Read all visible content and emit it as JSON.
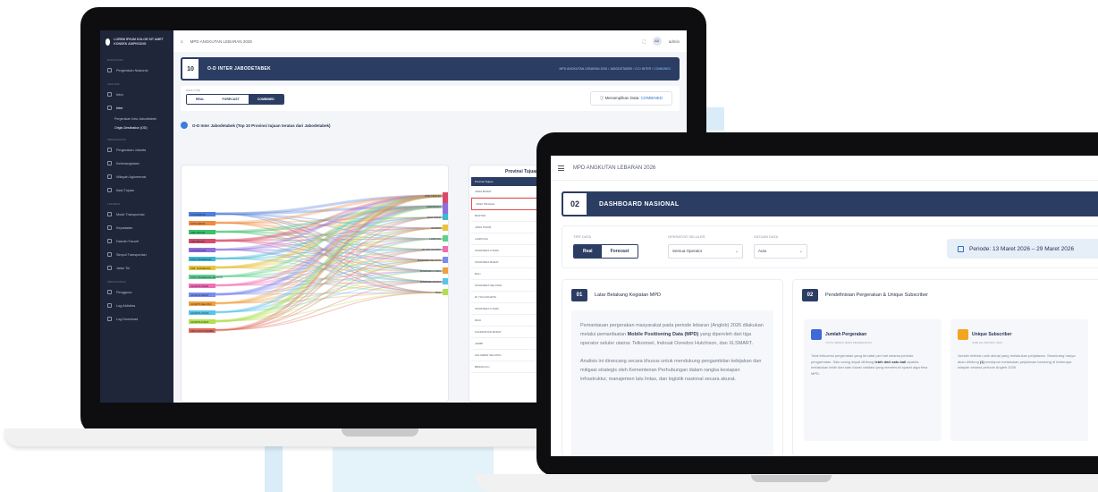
{
  "back_app": {
    "logo_text": "LOREM IPSUM DOLOR SIT AMET\nKONSEK ADIPISCING",
    "topbar_title": "MPD ANGKUTAN LEBARAN 2026",
    "user_initials": "AD",
    "user_name": "admin",
    "sidebar": {
      "sections": [
        "Ringkasan",
        "Analisis",
        "Pergerakan",
        "Laporan",
        "Pengaturan"
      ],
      "items": [
        "Pergerakan Nasional",
        "Intra",
        "Inter",
        "Pergerakan Jakarta",
        "Keberangkatan",
        "Wilayah Aglomerasi",
        "Asal-Tujuan",
        "Mode Transportasi",
        "Kepadatan",
        "Daerah Favorit",
        "Simpul Transportasi",
        "Jalan Tol",
        "Jalan Arteri",
        "Pengguna",
        "Log Aktivitas",
        "Log Download"
      ],
      "sub_items": [
        "Pergerakan Intra Jabodetabek",
        "Origin-Destination (OD)"
      ]
    },
    "header": {
      "number": "10",
      "title": "O-D INTER JABODETABEK",
      "breadcrumb": "MPD ANGKUTAN LEBARAN 2026 / JABODETABEK / O-D INTER /",
      "breadcrumb_active": "COMBINED"
    },
    "filter": {
      "label": "DATA TYPE",
      "options": [
        "REAL",
        "FORECAST",
        "COMBINED"
      ],
      "selected": "COMBINED",
      "info_label": "Menampilkan Data:",
      "info_value": "COMBINED"
    },
    "section_title": "O-D Inter Jabodetabek (Top 10 Provinsi tujuan teratas dari Jabodetabek)",
    "sankey": {
      "sources": [
        "KOTA BEKASI",
        "KOTA DEPOK",
        "KAB. BOGOR",
        "KAB. BEKASI",
        "KOTA BOGOR",
        "KOTA TANGERANG",
        "KAB. TANGERANG",
        "KOTA TANGERANG SELATAN",
        "JAKARTA TIMUR",
        "JAKARTA BARAT",
        "JAKARTA SELATAN",
        "JAKARTA UTARA",
        "JAKARTA PUSAT",
        "KEPULAUAN SERIBU"
      ],
      "targets": [
        "JAWA TENGAH",
        "JAWA BARAT",
        "JAWA TIMUR",
        "BANTEN",
        "LAMPUNG",
        "DI YOGYAKARTA",
        "SUMATERA SELATAN",
        "SUMATERA UTARA",
        "SUMATERA BARAT",
        "BALI"
      ],
      "colors": [
        "#4f7fd8",
        "#f08a3c",
        "#3cc06b",
        "#d94a6a",
        "#8f6fe0",
        "#3cb8d0",
        "#e8c43c",
        "#5fd08f",
        "#f06fb2",
        "#7a8cf0",
        "#f0a03c",
        "#59c4e8",
        "#b0e050",
        "#e06a5a"
      ]
    },
    "provinsi": {
      "title": "Provinsi Tujuan",
      "header": "Provinsi Tujuan",
      "rows": [
        "JAWA BARAT",
        "JAWA TENGAH",
        "BANTEN",
        "JAWA TIMUR",
        "LAMPUNG",
        "SUMATERA UTARA",
        "SUMATERA BARAT",
        "BALI",
        "SUMATERA SELATAN",
        "DI YOGYAKARTA",
        "SUMATERA UTARA",
        "RIAU",
        "KALIMANTAN BARAT",
        "JAMBI",
        "SULAWESI SELATAN",
        "BENGKULU"
      ]
    }
  },
  "front_app": {
    "topbar_title": "MPD ANGKUTAN LEBARAN 2026",
    "header": {
      "number": "02",
      "title": "DASHBOARD NASIONAL"
    },
    "filters": {
      "type_label": "TIPE DATA",
      "type_options": [
        "Real",
        "Forecast"
      ],
      "type_selected": "Real",
      "operator_label": "OPERATOR SELULER",
      "operator_value": "Semua Operator",
      "unit_label": "SATUAN DATA",
      "unit_value": "Auto",
      "period": "Periode: 13 Maret 2026 – 29 Maret 2026"
    },
    "card_latar": {
      "number": "01",
      "title": "Latar Belakang Kegiatan MPD",
      "paragraphs": [
        [
          "Pemantauan pergerakan masyarakat pada periode lebaran (Angleb) 2026 dilakukan melalui pemanfaatan ",
          "Mobile Positioning Data (MPD)",
          " yang diperoleh dari tiga operator seluler utama: Telkomsel, Indosat Ooredoo Hutchison, dan XLSMART."
        ],
        [
          "Analisis ini dirancang secara khusus untuk mendukung pengambilan kebijakan dan mitigasi strategis oleh Kementerian Perhubungan dalam rangka kesiapan infrastruktur, manajemen lalu lintas, dan logistik nasional secara akurat."
        ]
      ]
    },
    "card_definisi": {
      "number": "02",
      "title": "Pendefinisian Pergerakan & Unique Subscriber",
      "jumlah": {
        "title": "Jumlah Pergerakan",
        "subtitle": "TOTAL SEMUA JENIS PERGERAKAN",
        "text_a": "Total frekuensi pergerakan yang tercatat per hari selama periode pengamatan. Satu orang dapat dihitung ",
        "text_bold": "lebih dari satu kali",
        "text_b": " apabila melakukan lebih dari satu lokasi validasi yang memenuhi syarat algoritma MPD."
      },
      "unique": {
        "title": "Unique Subscriber",
        "subtitle": "JUMLAH INDIVIDU UNIK",
        "text_a": "Jumlah individu unik aktual yang melakukan perjalanan. Seseorang hanya akan dihitung ",
        "text_bold": "(1)",
        "text_b": " meskipun melakukan perjalanan berulang di beberapa wilayah selama periode Angleb 2026."
      }
    }
  },
  "colors": {
    "navy": "#2b3d63",
    "accent_blue": "#3c7ddd",
    "jumlah_icon": "#4169d6",
    "unique_icon": "#f2a51f",
    "highlight": "#e34b4b"
  }
}
